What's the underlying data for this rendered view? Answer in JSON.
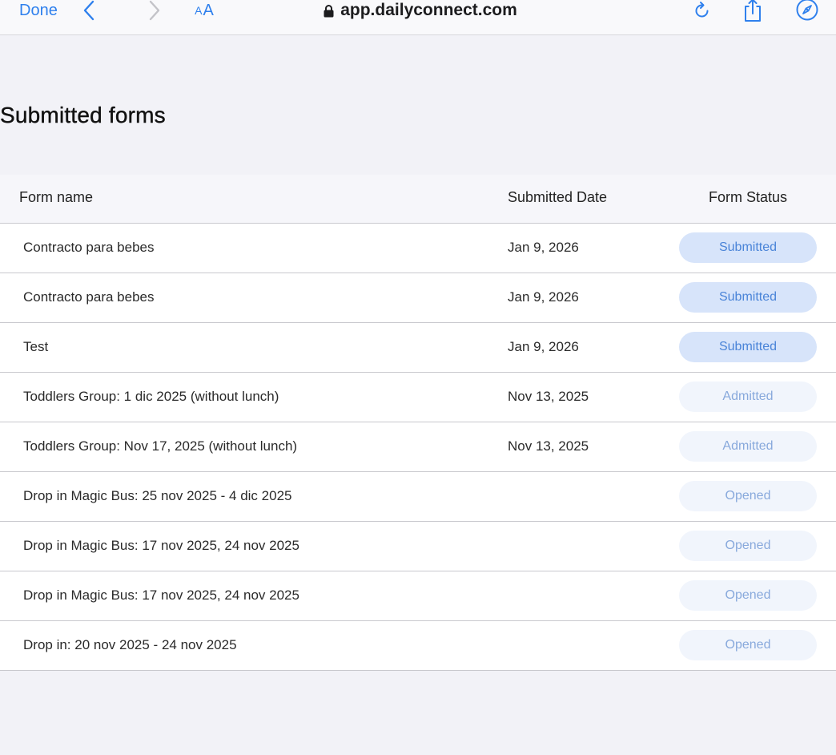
{
  "browser": {
    "done_label": "Done",
    "aa_small": "A",
    "aa_large": "A",
    "url": "app.dailyconnect.com",
    "accent_color": "#2f80ed"
  },
  "page": {
    "title": "Submitted forms"
  },
  "table": {
    "headers": {
      "name": "Form name",
      "date": "Submitted Date",
      "status": "Form Status"
    },
    "rows": [
      {
        "name": "Contracto para bebes",
        "date": "Jan 9, 2026",
        "status": "Submitted",
        "status_type": "submitted"
      },
      {
        "name": "Contracto para bebes",
        "date": "Jan 9, 2026",
        "status": "Submitted",
        "status_type": "submitted"
      },
      {
        "name": "Test",
        "date": "Jan 9, 2026",
        "status": "Submitted",
        "status_type": "submitted"
      },
      {
        "name": "Toddlers Group: 1 dic 2025 (without lunch)",
        "date": "Nov 13, 2025",
        "status": "Admitted",
        "status_type": "admitted"
      },
      {
        "name": "Toddlers Group: Nov 17, 2025 (without lunch)",
        "date": "Nov 13, 2025",
        "status": "Admitted",
        "status_type": "admitted"
      },
      {
        "name": "Drop in Magic Bus: 25 nov 2025 - 4 dic 2025",
        "date": "",
        "status": "Opened",
        "status_type": "opened"
      },
      {
        "name": "Drop in Magic Bus: 17 nov 2025, 24 nov 2025",
        "date": "",
        "status": "Opened",
        "status_type": "opened"
      },
      {
        "name": "Drop in Magic Bus: 17 nov 2025, 24 nov 2025",
        "date": "",
        "status": "Opened",
        "status_type": "opened"
      },
      {
        "name": "Drop in: 20 nov 2025 - 24 nov 2025",
        "date": "",
        "status": "Opened",
        "status_type": "opened"
      }
    ]
  },
  "status_colors": {
    "submitted_bg": "#d7e4fa",
    "submitted_text": "#4a84d8",
    "muted_bg": "#f1f5fc",
    "muted_text": "#88a9dc"
  }
}
